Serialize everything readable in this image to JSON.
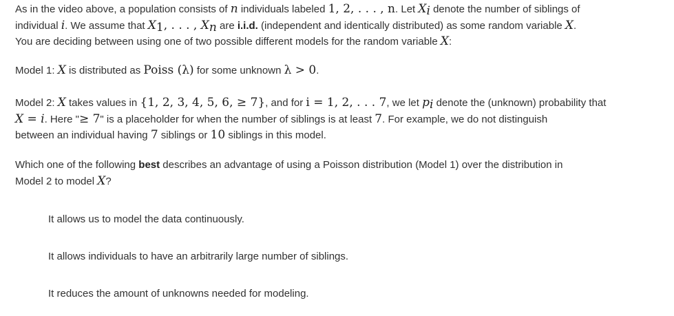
{
  "problem": {
    "intro": {
      "s1": "As in the video above, a population consists of ",
      "m1": "n",
      "s2": " individuals labeled ",
      "m2": "1, 2, . . . , n",
      "s3": ". Let ",
      "m3": "X",
      "m3sub": "i",
      "s4": " denote the number of siblings of",
      "s5": "individual ",
      "m5": "i",
      "s6": ". We assume that ",
      "m6a": "X",
      "m6asub": "1",
      "m6b": ", . . . , ",
      "m6c": "X",
      "m6csub": "n",
      "s7": " are ",
      "b7": "i.i.d.",
      "s8": " (independent and identically distributed) as some random variable ",
      "m8": "X",
      "s9": ".",
      "s10": "You are deciding between using one of two possible different models for the random variable ",
      "m10": "X",
      "s11": ":"
    },
    "model1": {
      "s1": "Model 1: ",
      "m1": "X",
      "s2": " is distributed as ",
      "m2": "Poiss (λ)",
      "s3": " for some unknown ",
      "m3": "λ > 0",
      "s4": "."
    },
    "model2": {
      "s1": "Model 2: ",
      "m1": "X",
      "s2": " takes values in ",
      "m2": "{1, 2, 3, 4, 5, 6, ≥ 7}",
      "s3": ", and for ",
      "m3": "i = 1, 2, . . . 7",
      "s4": ", we let ",
      "m4": "p",
      "m4sub": "i",
      "s5": " denote the (unknown) probability that",
      "m6": "X = i",
      "s7": ". Here \"",
      "m7": "≥ 7",
      "s8": "\" is a placeholder for when the number of siblings is at least ",
      "m8": "7",
      "s9": ". For example, we do not distinguish",
      "s10": "between an individual having ",
      "m10": "7",
      "s11": " siblings or ",
      "m11": "10",
      "s12": " siblings in this model."
    },
    "question": {
      "s1": "Which one of the following ",
      "b1": "best",
      "s2": " describes an advantage of using a Poisson distribution (Model 1) over the distribution in",
      "s3": "Model 2 to model ",
      "m3": "X",
      "s4": "?"
    }
  },
  "options": [
    "It allows us to model the data continuously.",
    "It allows individuals to have an arbitrarily large number of siblings.",
    "It reduces the amount of unknowns needed for modeling."
  ]
}
